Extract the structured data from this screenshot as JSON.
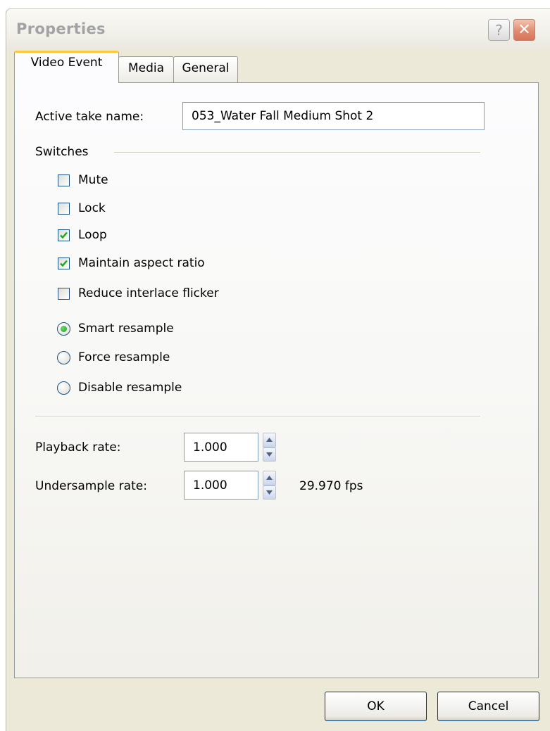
{
  "window": {
    "title": "Properties",
    "help_glyph": "?",
    "close_glyph": "✕"
  },
  "tabs": [
    {
      "label": "Video Event",
      "active": true
    },
    {
      "label": "Media",
      "active": false
    },
    {
      "label": "General",
      "active": false
    }
  ],
  "active_take": {
    "label": "Active take name:",
    "value": "053_Water Fall Medium Shot 2"
  },
  "switches": {
    "group_label": "Switches",
    "checkboxes": [
      {
        "label": "Mute",
        "checked": false
      },
      {
        "label": "Lock",
        "checked": false
      },
      {
        "label": "Loop",
        "checked": true
      },
      {
        "label": "Maintain aspect ratio",
        "checked": true
      },
      {
        "label": "Reduce interlace flicker",
        "checked": false
      }
    ],
    "radios": [
      {
        "label": "Smart resample",
        "selected": true
      },
      {
        "label": "Force resample",
        "selected": false
      },
      {
        "label": "Disable resample",
        "selected": false
      }
    ]
  },
  "playback_rate": {
    "label": "Playback rate:",
    "value": "1.000"
  },
  "undersample_rate": {
    "label": "Undersample rate:",
    "value": "1.000",
    "fps": "29.970 fps"
  },
  "buttons": {
    "ok": "OK",
    "cancel": "Cancel"
  },
  "colors": {
    "accent_tab": "#ffc83c",
    "check": "#21a121",
    "window_bg": "#ece9d8"
  }
}
